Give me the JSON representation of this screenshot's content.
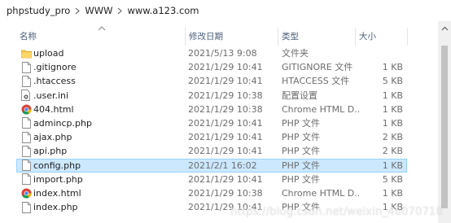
{
  "breadcrumb": {
    "items": [
      "phpstudy_pro",
      "WWW",
      "www.a123.com"
    ]
  },
  "columns": {
    "name": "名称",
    "date": "修改日期",
    "type": "类型",
    "size": "大小"
  },
  "files": [
    {
      "name": "upload",
      "date": "2021/5/13 9:08",
      "type": "文件夹",
      "size": "",
      "icon": "folder-icon"
    },
    {
      "name": ".gitignore",
      "date": "2021/1/29 10:41",
      "type": "GITIGNORE 文件",
      "size": "1 KB",
      "icon": "file-icon"
    },
    {
      "name": ".htaccess",
      "date": "2021/1/29 10:41",
      "type": "HTACCESS 文件",
      "size": "5 KB",
      "icon": "file-icon"
    },
    {
      "name": ".user.ini",
      "date": "2021/1/29 10:38",
      "type": "配置设置",
      "size": "1 KB",
      "icon": "settings-file-icon"
    },
    {
      "name": "404.html",
      "date": "2021/1/29 10:38",
      "type": "Chrome HTML D...",
      "size": "1 KB",
      "icon": "chrome-icon"
    },
    {
      "name": "admincp.php",
      "date": "2021/1/29 10:41",
      "type": "PHP 文件",
      "size": "1 KB",
      "icon": "file-icon"
    },
    {
      "name": "ajax.php",
      "date": "2021/1/29 10:41",
      "type": "PHP 文件",
      "size": "2 KB",
      "icon": "file-icon"
    },
    {
      "name": "api.php",
      "date": "2021/1/29 10:41",
      "type": "PHP 文件",
      "size": "2 KB",
      "icon": "file-icon"
    },
    {
      "name": "config.php",
      "date": "2021/2/1 16:02",
      "type": "PHP 文件",
      "size": "1 KB",
      "icon": "file-icon",
      "selected": true
    },
    {
      "name": "import.php",
      "date": "2021/1/29 10:41",
      "type": "PHP 文件",
      "size": "5 KB",
      "icon": "file-icon"
    },
    {
      "name": "index.html",
      "date": "2021/1/29 10:38",
      "type": "Chrome HTML D...",
      "size": "1 KB",
      "icon": "chrome-icon"
    },
    {
      "name": "index.php",
      "date": "2021/1/29 10:41",
      "type": "PHP 文件",
      "size": "1 KB",
      "icon": "file-icon"
    }
  ],
  "watermark": "https://blog.csdn.net/weixin_46070718"
}
